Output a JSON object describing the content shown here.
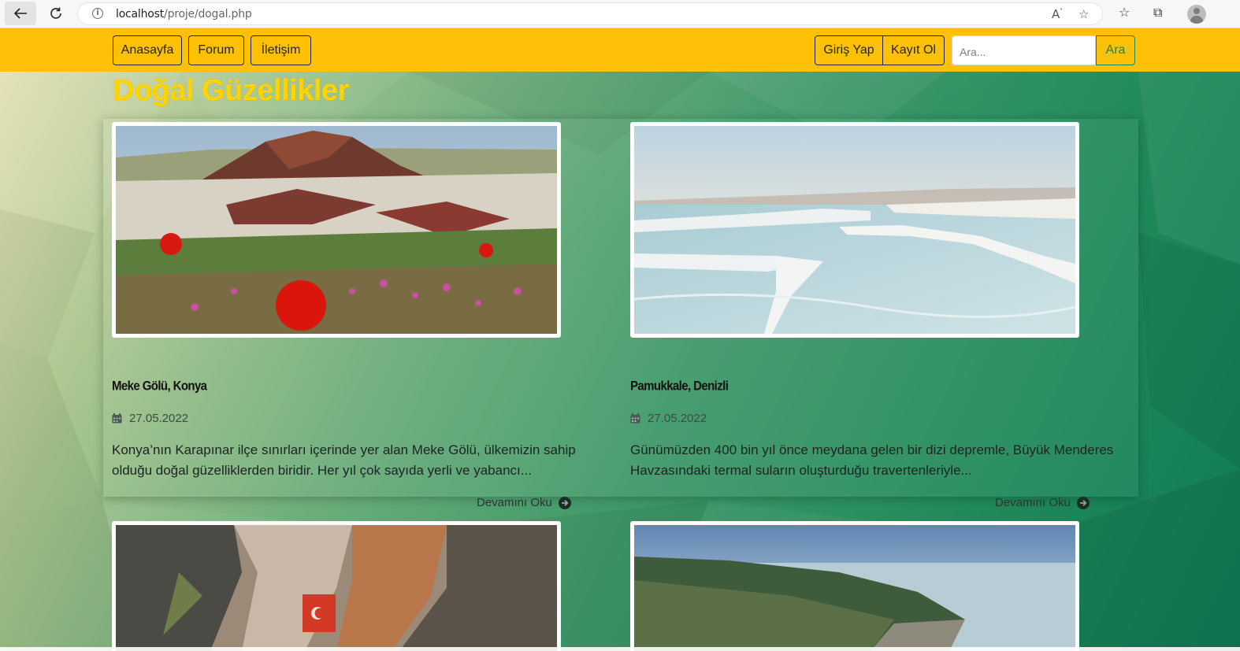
{
  "browser": {
    "url_host": "localhost",
    "url_path": "/proje/dogal.php"
  },
  "nav": {
    "home": "Anasayfa",
    "forum": "Forum",
    "contact": "İletişim",
    "login": "Giriş Yap",
    "register": "Kayıt Ol",
    "search_placeholder": "Ara...",
    "search_button": "Ara"
  },
  "page": {
    "title": "Doğal Güzellikler"
  },
  "cards": [
    {
      "title": "Meke Gölü, Konya",
      "date": "27.05.2022",
      "text": "Konya’nın Karapınar ilçe sınırları içerinde yer alan Meke Gölü, ülkemizin sahip olduğu doğal güzelliklerden biridir. Her yıl çok sayıda yerli ve yabancı...",
      "read_more": "Devamını Oku"
    },
    {
      "title": "Pamukkale, Denizli",
      "date": "27.05.2022",
      "text": "Günümüzden 400 bin yıl önce meydana gelen bir dizi depremle, Büyük Menderes Havzasındaki termal suların oluşturduğu travertenleriyle...",
      "read_more": "Devamını Oku"
    }
  ],
  "colors": {
    "navbar": "#ffc107",
    "title": "#ffd400",
    "search_accent": "#198754"
  }
}
